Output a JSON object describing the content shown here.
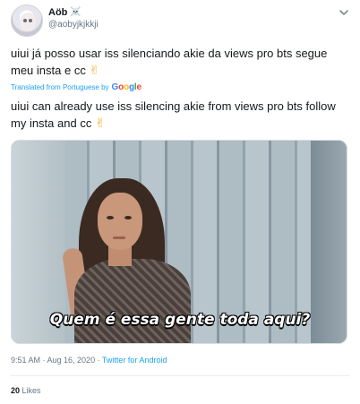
{
  "tweet": {
    "display_name": "Aöb",
    "name_emoji": "☠️",
    "handle": "@aobyjkjkkji",
    "original_text": "uiui já posso usar iss silenciando akie da views pro bts segue meu insta e cc",
    "emoji_icon": "victory-hand-emoji",
    "translated_from": "Translated from Portuguese by",
    "translator_logo": "Google",
    "translation_text": "uiui can already use iss silencing akie from views pro bts follow my insta and cc",
    "media": {
      "caption": "Quem é essa gente toda aqui?"
    },
    "timestamp": "9:51 AM · Aug 16, 2020 ·",
    "source": "Twitter for Android",
    "likes_count": "20",
    "likes_label": "Likes"
  },
  "colors": {
    "link": "#1da1f2",
    "secondary_text": "#657786",
    "primary_text": "#14171a"
  }
}
